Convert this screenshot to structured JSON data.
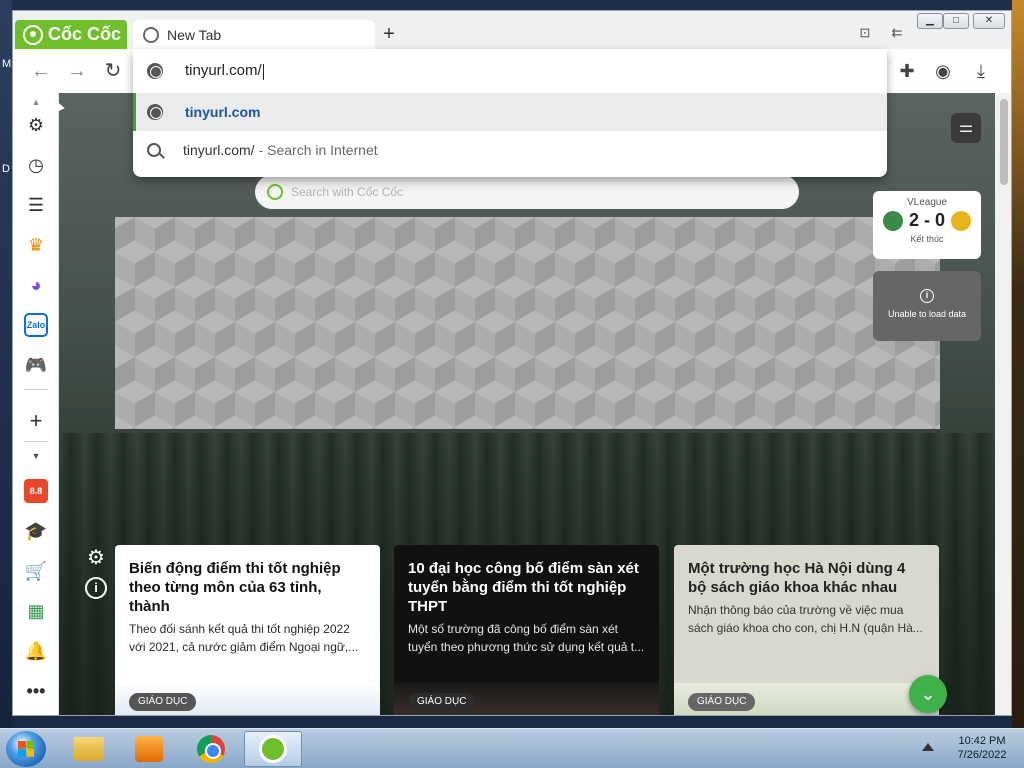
{
  "browser": {
    "brand": "Cốc Cốc",
    "tab_title": "New Tab",
    "new_tab_symbol": "+"
  },
  "omnibox": {
    "value": "tinyurl.com/",
    "suggestions": [
      {
        "text": "tinyurl.com",
        "subtext": "",
        "icon": "globe-icon",
        "selected": true
      },
      {
        "text": "tinyurl.com/",
        "subtext": "- Search in Internet",
        "icon": "search-icon",
        "selected": false
      }
    ]
  },
  "newtab": {
    "search_placeholder": "Search with Cốc Cốc",
    "score": {
      "league": "VLeague",
      "score": "2 - 0",
      "status": "Kết thúc"
    },
    "error_text": "Unable to load data",
    "news": [
      {
        "title": "Biến động điểm thi tốt nghiệp theo từng môn của 63 tỉnh, thành",
        "desc": "Theo đối sánh kết quả thi tốt nghiệp 2022 với 2021, cả nước giảm điểm Ngoại ngữ,...",
        "tag": "GIÁO DỤC"
      },
      {
        "title": "10 đại học công bố điểm sàn xét tuyển bằng điểm thi tốt nghiệp THPT",
        "desc": "Một số trường đã công bố điểm sàn xét tuyển theo phương thức sử dụng kết quả t...",
        "tag": "GIÁO DỤC"
      },
      {
        "title": "Một trường học Hà Nội dùng 4 bộ sách giáo khoa khác nhau",
        "desc": "Nhận thông báo của trường về việc mua sách giáo khoa cho con, chị H.N (quận Hà...",
        "tag": "GIÁO DỤC"
      }
    ]
  },
  "desktop": {
    "left_chars": [
      "M",
      "D"
    ]
  },
  "taskbar": {
    "time": "10:42 PM",
    "date": "7/26/2022"
  },
  "colors": {
    "brand_green": "#6fbf2a",
    "selection_bar": "#3da33a",
    "link_blue": "#1a56a8"
  }
}
